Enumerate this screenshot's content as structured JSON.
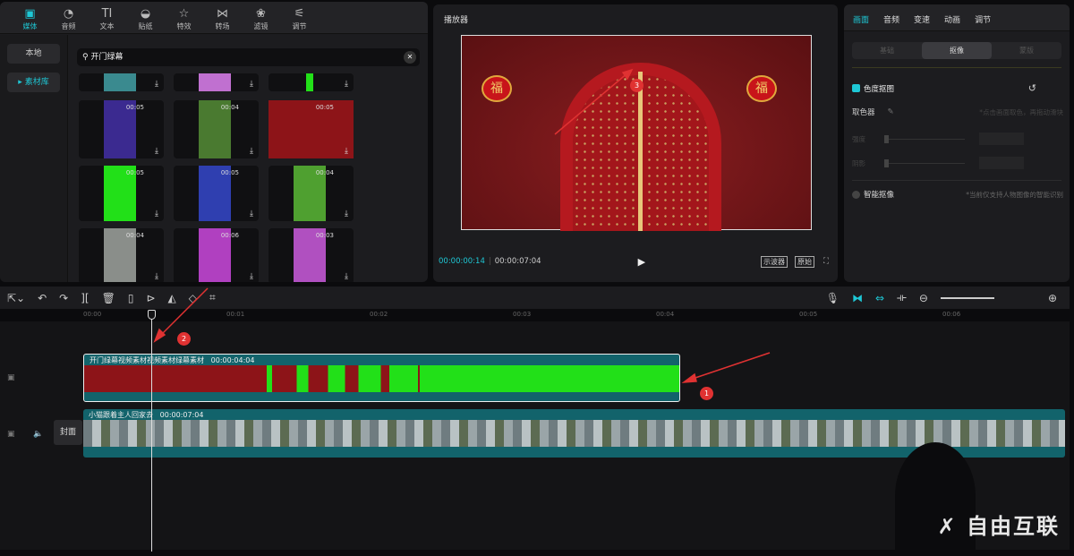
{
  "media_panel": {
    "tabs": [
      {
        "label": "媒体",
        "icon": "media-icon"
      },
      {
        "label": "音频",
        "icon": "audio-icon"
      },
      {
        "label": "文本",
        "icon": "text-icon"
      },
      {
        "label": "贴纸",
        "icon": "sticker-icon"
      },
      {
        "label": "特效",
        "icon": "effects-icon"
      },
      {
        "label": "转场",
        "icon": "transition-icon"
      },
      {
        "label": "滤镜",
        "icon": "filter-icon"
      },
      {
        "label": "调节",
        "icon": "adjust-icon"
      }
    ],
    "side": [
      {
        "label": "本地"
      },
      {
        "label": "素材库"
      }
    ],
    "search_value": "开门绿幕",
    "items": [
      {
        "duration": ""
      },
      {
        "duration": ""
      },
      {
        "duration": ""
      },
      {
        "duration": "00:05"
      },
      {
        "duration": "00:04"
      },
      {
        "duration": "00:05"
      },
      {
        "duration": "00:05"
      },
      {
        "duration": "00:05"
      },
      {
        "duration": "00:04"
      },
      {
        "duration": "00:04"
      },
      {
        "duration": "00:06"
      },
      {
        "duration": "00:03"
      }
    ]
  },
  "player": {
    "title": "播放器",
    "current_time": "00:00:00:14",
    "total_time": "00:00:07:04",
    "scope_label": "示波器",
    "ratio_label": "原始",
    "lantern_char": "福"
  },
  "props": {
    "tabs": [
      "画面",
      "音频",
      "变速",
      "动画",
      "调节"
    ],
    "subtabs": [
      "基础",
      "抠像",
      "蒙版"
    ],
    "chroma_key": {
      "label": "色度抠图",
      "checked": true
    },
    "picker_label": "取色器",
    "picker_hint": "*点击画面取色，再拖动滑块",
    "sliders": [
      "强度",
      "阴影"
    ],
    "smart_cutout": {
      "label": "智能抠像",
      "checked": false,
      "hint": "*当前仅支持人物图像的智能识别"
    }
  },
  "timeline": {
    "ruler": [
      "00:00",
      "00:01",
      "00:02",
      "00:03",
      "00:04",
      "00:05",
      "00:06"
    ],
    "clips": [
      {
        "name": "开门绿幕视频素材视频素材绿幕素材",
        "duration": "00:00:04:04"
      },
      {
        "name": "小猫跟着主人回家去",
        "duration": "00:00:07:04"
      }
    ],
    "cover_label": "封面",
    "annotations": [
      "1",
      "2",
      "3"
    ]
  },
  "watermark": "自由互联",
  "colors": {
    "accent": "#1ec8d6",
    "green_screen": "#22e018",
    "clip_teal": "#12636b"
  }
}
